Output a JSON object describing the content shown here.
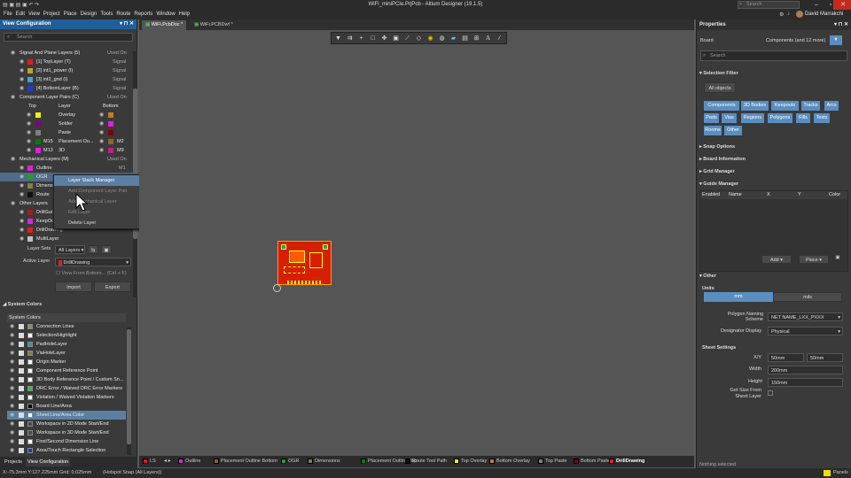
{
  "window": {
    "title": "WiFi_miniPCIe.PrjPcb - Altium Designer (19.1.5)",
    "search_placeholder": "Search",
    "user": "David Marrakchi"
  },
  "menu": [
    "File",
    "Edit",
    "View",
    "Project",
    "Place",
    "Design",
    "Tools",
    "Route",
    "Reports",
    "Window",
    "Help"
  ],
  "left_panel": {
    "title": "View Configuration",
    "search_placeholder": "Search",
    "signal_header": "Signal And Plane Layers (5)",
    "used_on": "Used On",
    "signal_layers": [
      {
        "name": "[1] TopLayer (T)",
        "color": "#e01b1b",
        "type": "Signal"
      },
      {
        "name": "[2] int1_power (I)",
        "color": "#c8a028",
        "type": "Signal"
      },
      {
        "name": "[3] int2_gnd (I)",
        "color": "#4aa0d8",
        "type": "Signal"
      },
      {
        "name": "[4] BottomLayer (B)",
        "color": "#1e3cd2",
        "type": "Signal"
      }
    ],
    "pair_header": "Component Layer Pairs (C)",
    "pair_cols": [
      "Top",
      "Layer",
      "Bottom"
    ],
    "pairs": [
      {
        "layer": "Overlay",
        "top": "#f0f000",
        "bottom": "#c08020"
      },
      {
        "layer": "Solder",
        "top": "#800080",
        "bottom": "#e020e0"
      },
      {
        "layer": "Paste",
        "top": "#808080",
        "bottom": "#800000"
      },
      {
        "layer": "Placement Ou...",
        "top": "#008000",
        "bottom": "#8a6a20",
        "lt": "M15",
        "lb": "M2"
      },
      {
        "layer": "3D",
        "top": "#e020e0",
        "bottom": "#c02080",
        "lt": "M13",
        "lb": "M9"
      }
    ],
    "mech_header": "Mechanical Layers (M)",
    "mech_layers": [
      {
        "name": "Outline",
        "color": "#e020e0",
        "code": "M1"
      },
      {
        "name": "OGR",
        "color": "#20a020"
      },
      {
        "name": "Dimensi",
        "color": "#808040"
      },
      {
        "name": "Route",
        "color": "#101010"
      }
    ],
    "other_header": "Other Layers",
    "other_layers": [
      {
        "name": "DrillGui",
        "color": "#a02020"
      },
      {
        "name": "KeepOu",
        "color": "#e020e0"
      },
      {
        "name": "DrillDrawing",
        "color": "#e02020"
      },
      {
        "name": "MultiLayer",
        "color": "#c0c0c0"
      }
    ],
    "layer_sets_label": "Layer Sets",
    "layer_sets_value": "All Layers",
    "active_layer_label": "Active Layer",
    "active_layer_value": "DrillDrawing",
    "view_from_bottom": "View From Bottom...",
    "view_from_bottom_shortcut": "(Ctrl + F)",
    "import": "Import",
    "export": "Export",
    "system_colors_header": "System Colors",
    "system_colors_sub": "System Colors",
    "system_colors": [
      {
        "name": "Connection Lines",
        "color": "#8a8a6a"
      },
      {
        "name": "Selection/Highlight",
        "color": "#ffffff"
      },
      {
        "name": "PadHoleLayer",
        "color": "#20a0a0"
      },
      {
        "name": "ViaHoleLayer",
        "color": "#808040"
      },
      {
        "name": "Origin Marker",
        "color": "#ffffff"
      },
      {
        "name": "Component Reference Point",
        "color": "#ffffff"
      },
      {
        "name": "3D Body Reference Point / Custom Sn...",
        "color": "#ffffff"
      },
      {
        "name": "DRC Error / Waived DRC Error Markers",
        "color": "#20d020"
      },
      {
        "name": "Violation / Waived Violation Markers",
        "color": "#ffffff"
      },
      {
        "name": "Board Line/Area",
        "color": "#000000"
      },
      {
        "name": "Sheet Line/Area Color",
        "color": "#ffffff"
      },
      {
        "name": "Workspace in 2D Mode Start/End",
        "color": "#4a4a4a"
      },
      {
        "name": "Workspace in 3D Mode Start/End",
        "color": "#4a4a4a"
      },
      {
        "name": "First/Second Dimension Line",
        "color": "#ffffff"
      },
      {
        "name": "Area/Touch Rectangle Selection",
        "color": "#1040c0"
      }
    ],
    "bottom_tabs": [
      "Projects",
      "View Configuration"
    ]
  },
  "context_menu": [
    "Layer Stack Manager",
    "Add Component Layer Pair",
    "Add Mechanical Layer",
    "Edit Layer",
    "Delete Layer"
  ],
  "doc_tabs": [
    "WiFi.PcbDoc *",
    "WiFi.PCBDwf *"
  ],
  "layer_tabs": [
    {
      "name": "LS",
      "color": "#e01b1b"
    },
    {
      "name": "Outline",
      "color": "#e020e0"
    },
    {
      "name": "Placement Outline Bottom",
      "color": "#8a6a20"
    },
    {
      "name": "OGR",
      "color": "#20a020"
    },
    {
      "name": "Dimensions",
      "color": "#808040"
    },
    {
      "name": "Placement Outline Top",
      "color": "#008000"
    },
    {
      "name": "Route Tool Path",
      "color": "#101010"
    },
    {
      "name": "Top Overlay",
      "color": "#f0f000"
    },
    {
      "name": "Bottom Overlay",
      "color": "#c08020"
    },
    {
      "name": "Top Paste",
      "color": "#808080"
    },
    {
      "name": "Bottom Paste",
      "color": "#800000"
    },
    {
      "name": "DrillDrawing",
      "color": "#e02020"
    }
  ],
  "status": {
    "coords": "X:-75.3mm Y:127.225mm",
    "grid": "Grid: 0.025mm",
    "snap": "(Hotspot Snap (All Layers))",
    "panels": "Panels",
    "selection": "Nothing selected"
  },
  "properties": {
    "title": "Properties",
    "type": "Board",
    "scope": "Components (and 12 more)",
    "search_placeholder": "Search",
    "selection_filter": "Selection Filter",
    "all_objects": "All objects",
    "filter_chips": [
      "Components",
      "3D Bodies",
      "Keepouts",
      "Tracks",
      "Arcs",
      "Pads",
      "Vias",
      "Regions",
      "Polygons",
      "Fills",
      "Texts",
      "Rooms",
      "Other"
    ],
    "sections": [
      "Snap Options",
      "Board Information",
      "Grid Manager",
      "Guide Manager"
    ],
    "guide_cols": [
      "Enabled",
      "Name",
      "X",
      "Y",
      "Color"
    ],
    "add": "Add",
    "place": "Place",
    "other": "Other",
    "units": "Units",
    "mm": "mm",
    "mils": "mils",
    "polygon_naming_label": "Polygon Naming Scheme",
    "polygon_naming_value": "NET NAME_LXX_PXXX",
    "designator_label": "Designator Display",
    "designator_value": "Physical",
    "sheet_settings": "Sheet Settings",
    "xy_label": "X/Y",
    "x_value": "50mm",
    "y_value": "50mm",
    "width_label": "Width",
    "width_value": "200mm",
    "height_label": "Height",
    "height_value": "150mm",
    "auto_size_label": "Get Size From Sheet Layer"
  }
}
